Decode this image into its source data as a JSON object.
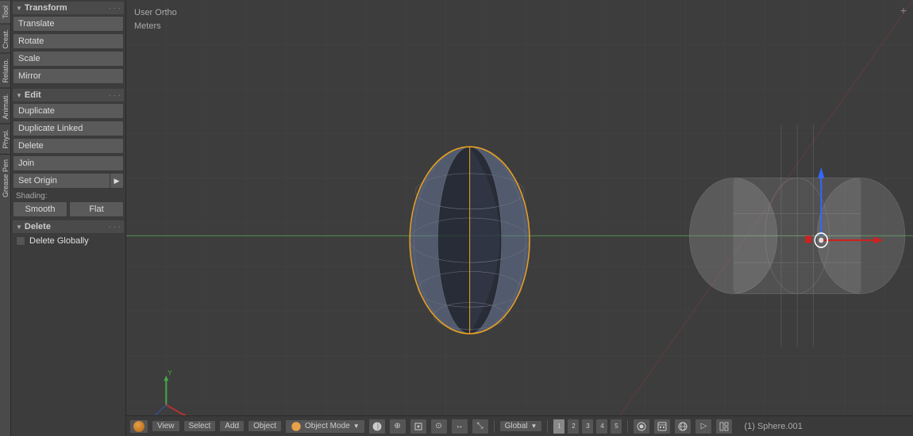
{
  "viewport": {
    "view_type": "User Ortho",
    "units": "Meters",
    "selected_object": "(1) Sphere.001"
  },
  "tool_panel": {
    "transform_section": "Transform",
    "edit_section": "Edit",
    "delete_section": "Delete",
    "translate_label": "Translate",
    "rotate_label": "Rotate",
    "scale_label": "Scale",
    "mirror_label": "Mirror",
    "duplicate_label": "Duplicate",
    "duplicate_linked_label": "Duplicate Linked",
    "delete_label": "Delete",
    "join_label": "Join",
    "set_origin_label": "Set Origin",
    "shading_label": "Shading:",
    "smooth_label": "Smooth",
    "flat_label": "Flat",
    "delete_globally_label": "Delete Globally"
  },
  "vertical_tabs": {
    "tool_label": "Tool",
    "create_label": "Creat.",
    "relations_label": "Relatio.",
    "animation_label": "Animati.",
    "physics_label": "Physi.",
    "grease_pen_label": "Grease Pen"
  },
  "status_bar": {
    "view_label": "View",
    "select_label": "Select",
    "add_label": "Add",
    "object_label": "Object",
    "mode_label": "Object Mode",
    "global_label": "Global"
  }
}
